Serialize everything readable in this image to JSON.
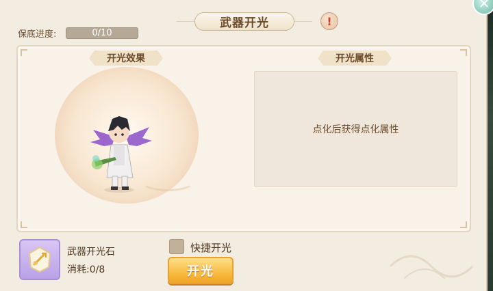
{
  "header": {
    "title": "武器开光",
    "alert_symbol": "!",
    "close_symbol": "✕"
  },
  "progress": {
    "label": "保底进度:",
    "value": "0/10",
    "current": 0,
    "max": 10
  },
  "effect_section": {
    "tab_label": "开光效果"
  },
  "attribute_section": {
    "tab_label": "开光属性",
    "placeholder": "点化后获得点化属性"
  },
  "material": {
    "name": "武器开光石",
    "cost_label": "消耗:",
    "cost_value": "0/8",
    "icon": "light-stone-icon"
  },
  "quick_option": {
    "label": "快捷开光",
    "checked": false
  },
  "action": {
    "label": "开光"
  },
  "colors": {
    "accent": "#f7b638",
    "text": "#6b4a2a",
    "panel": "#f3ece0"
  }
}
